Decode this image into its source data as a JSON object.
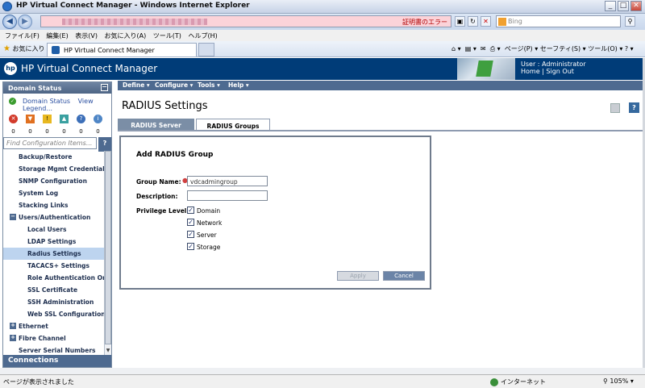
{
  "browser": {
    "window_title": "HP Virtual Connect Manager - Windows Internet Explorer",
    "cert_error": "証明書のエラー",
    "search_placeholder": "Bing",
    "menu": [
      "ファイル(F)",
      "編集(E)",
      "表示(V)",
      "お気に入り(A)",
      "ツール(T)",
      "ヘルプ(H)"
    ],
    "favorites_label": "お気に入り",
    "tab_title": "HP Virtual Connect Manager",
    "command_bar": "ページ(P) ▾  セーフティ(S) ▾  ツール(O) ▾  ",
    "status_text": "ページが表示されました",
    "zone": "インターネット",
    "zoom": "105%"
  },
  "app": {
    "logo": "hp",
    "name": "HP Virtual Connect Manager",
    "user_line": "User : Administrator",
    "home_link": "Home",
    "separator": "|",
    "signout_link": "Sign Out"
  },
  "sidebar": {
    "domain_status_title": "Domain Status",
    "domain_status_link": "Domain Status",
    "view_legend_link": "View Legend...",
    "status_counts": [
      "0",
      "0",
      "0",
      "0",
      "0",
      "0"
    ],
    "find_placeholder": "Find Configuration Items...",
    "find_button": "?",
    "items": [
      {
        "label": "Backup/Restore"
      },
      {
        "label": "Storage Mgmt Credentials"
      },
      {
        "label": "SNMP Configuration"
      },
      {
        "label": "System Log"
      },
      {
        "label": "Stacking Links"
      },
      {
        "label": "Users/Authentication"
      },
      {
        "label": "Local Users"
      },
      {
        "label": "LDAP Settings"
      },
      {
        "label": "Radius Settings"
      },
      {
        "label": "TACACS+ Settings"
      },
      {
        "label": "Role Authentication Order"
      },
      {
        "label": "SSL Certificate"
      },
      {
        "label": "SSH Administration"
      },
      {
        "label": "Web SSL Configuration"
      },
      {
        "label": "Ethernet"
      },
      {
        "label": "Fibre Channel"
      },
      {
        "label": "Server Serial Numbers"
      }
    ],
    "connections": "Connections"
  },
  "topnav": [
    "Define ▾",
    "Configure ▾",
    "Tools ▾",
    "Help ▾"
  ],
  "page": {
    "title": "RADIUS Settings",
    "help_icon": "?",
    "tabs": [
      "RADIUS Server",
      "RADIUS Groups"
    ],
    "form": {
      "title": "Add RADIUS Group",
      "group_name_label": "Group Name:",
      "group_name_value": "vdcadmingroup",
      "description_label": "Description:",
      "description_value": "",
      "privilege_label": "Privilege Level:",
      "privileges": [
        {
          "label": "Domain",
          "checked": true
        },
        {
          "label": "Network",
          "checked": true
        },
        {
          "label": "Server",
          "checked": true
        },
        {
          "label": "Storage",
          "checked": true
        }
      ],
      "apply": "Apply",
      "cancel": "Cancel"
    }
  }
}
